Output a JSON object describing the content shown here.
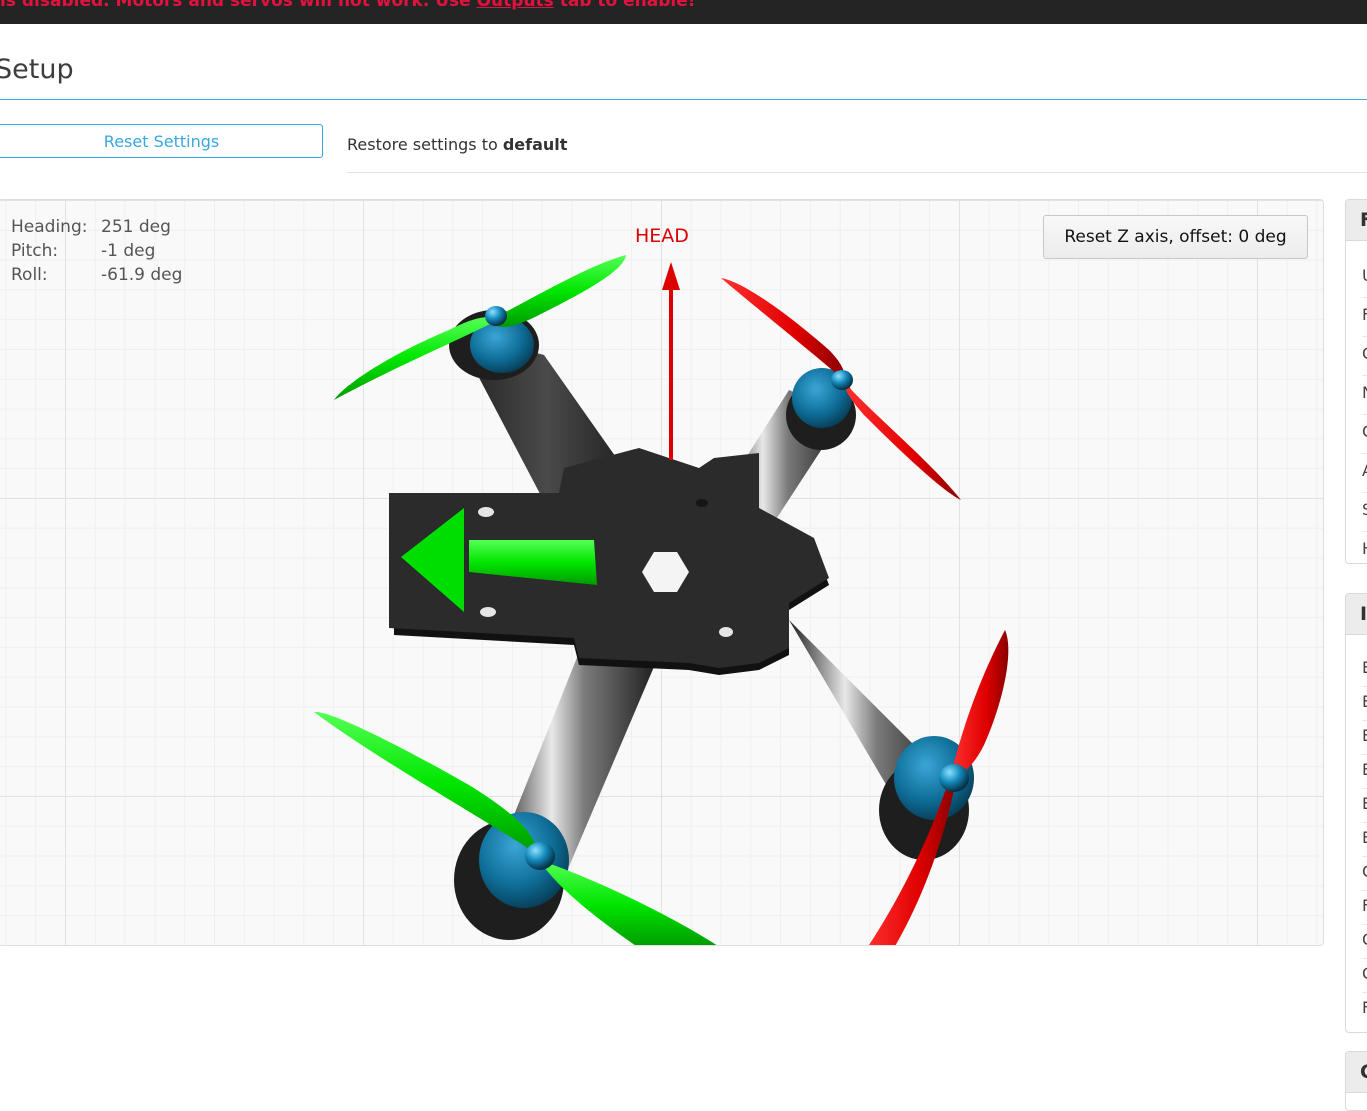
{
  "warning": {
    "prefix": "is disabled. Motors and servos will not work. Use ",
    "link": "Outputs",
    "suffix": " tab to enable!"
  },
  "page": {
    "title": "Setup"
  },
  "reset": {
    "button_label": "Reset Settings",
    "restore_prefix": "Restore settings to ",
    "restore_bold": "default"
  },
  "attitude": {
    "heading_label": "Heading:",
    "heading_value": "251 deg",
    "pitch_label": "Pitch:",
    "pitch_value": "-1 deg",
    "roll_label": "Roll:",
    "roll_value": "-61.9 deg"
  },
  "model": {
    "head_label": "HEAD",
    "reset_z_label": "Reset Z axis, offset: 0 deg"
  },
  "sidebar": {
    "box1": {
      "head": "F",
      "items": [
        "U",
        "F",
        "C",
        "N",
        "C",
        "A",
        "S",
        "H"
      ]
    },
    "box2": {
      "head": "I",
      "items": [
        "E",
        "E",
        "E",
        "E",
        "E",
        "E",
        "C",
        "F",
        "C",
        "C",
        "F"
      ]
    },
    "box3": {
      "head": "C"
    }
  },
  "colors": {
    "accent": "#37a8db",
    "warning": "#e2123f",
    "prop_green": "#00ee00",
    "prop_red": "#ee0000",
    "frame": "#2b2b2b",
    "motor": "#0e6d97"
  }
}
